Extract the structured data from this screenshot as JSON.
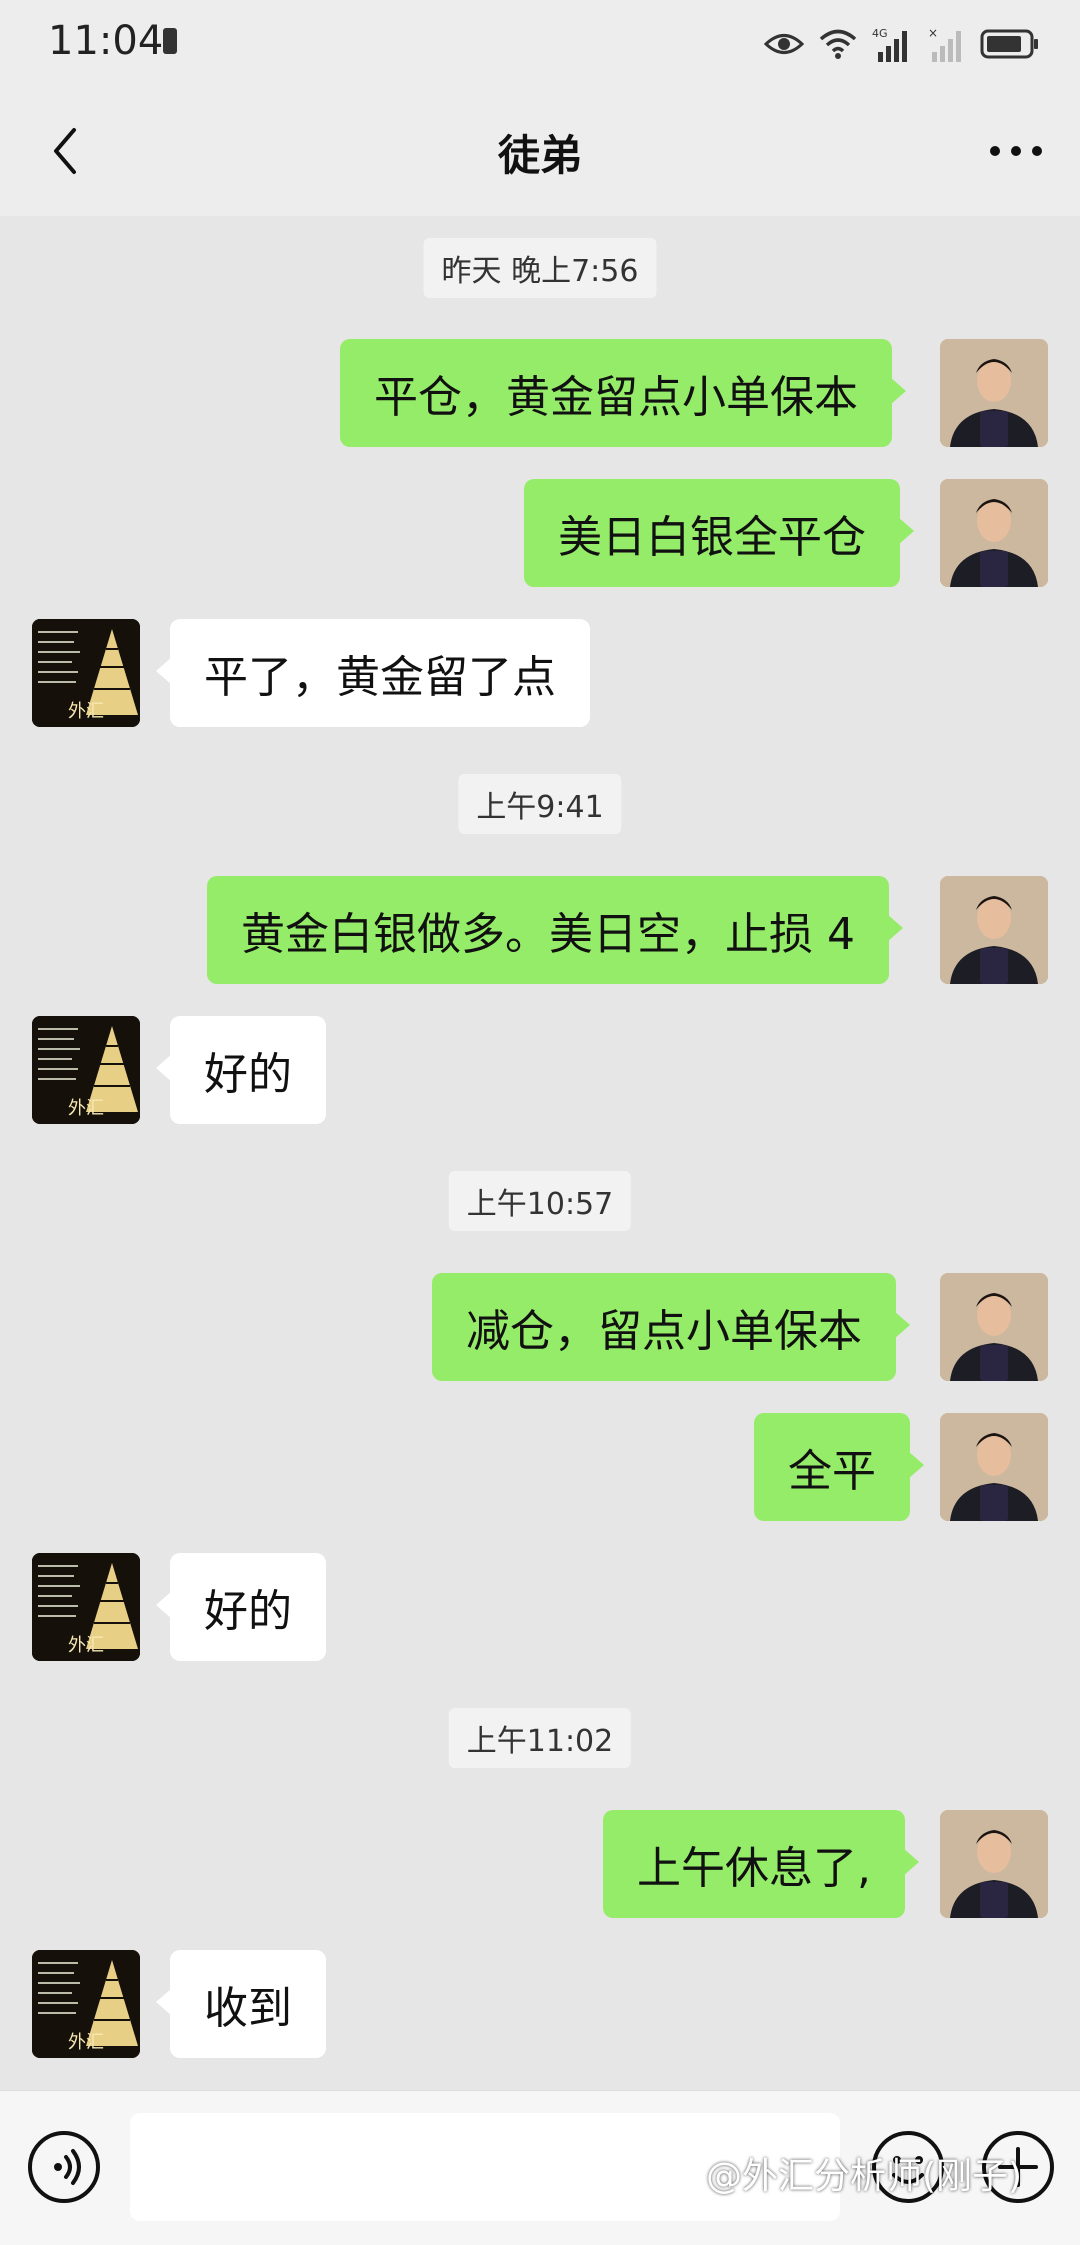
{
  "status_bar": {
    "time": "11:04",
    "network": "4G",
    "icons": [
      "battery-saver-icon",
      "eye-icon",
      "wifi-icon",
      "signal-4g-icon",
      "signal-nosim-icon",
      "battery-icon"
    ]
  },
  "nav": {
    "title": "徒弟",
    "back_icon": "chevron-left-icon",
    "more_icon": "more-dots-icon"
  },
  "messages": {
    "t1": "昨天 晚上7:56",
    "m1": "平仓，黄金留点小单保本",
    "m2": "美日白银全平仓",
    "m3": "平了，黄金留了点",
    "t2": "上午9:41",
    "m4": "黄金白银做多。美日空，止损 4",
    "m5": "好的",
    "t3": "上午10:57",
    "m6": "减仓，留点小单保本",
    "m7": "全平",
    "m8": "好的",
    "t4": "上午11:02",
    "m9": "上午休息了,",
    "m10": "收到"
  },
  "peer_avatar_label": "外汇",
  "input_bar": {
    "value": "",
    "voice_icon": "voice-icon",
    "emoji_icon": "emoji-icon",
    "plus_icon": "plus-icon"
  },
  "watermark": "@外汇分析师(刚子)",
  "colors": {
    "outgoing_bubble": "#95ec69",
    "incoming_bubble": "#ffffff",
    "background": "#e6e6e6"
  }
}
